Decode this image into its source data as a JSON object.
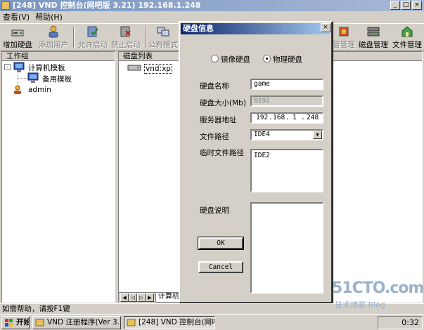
{
  "window": {
    "title": "[248] VND 控制台(网吧版 3.21) 192.168.1.248",
    "min": "_",
    "max": "□",
    "close": "×"
  },
  "menu": [
    "查看(V)",
    "帮助(H)"
  ],
  "toolbar": [
    {
      "label": "增加硬盘",
      "icon": "add-disk-icon"
    },
    {
      "label": "添加用户",
      "icon": "add-user-icon"
    },
    {
      "label": "允许启动",
      "icon": "allow-boot-icon"
    },
    {
      "label": "禁止启动",
      "icon": "deny-boot-icon"
    },
    {
      "label": "公有模式",
      "icon": "public-mode-icon"
    },
    {
      "label": "管管理",
      "icon": "manage-icon"
    },
    {
      "label": "磁盘管理",
      "icon": "disk-manage-icon"
    },
    {
      "label": "文件管理",
      "icon": "file-manage-icon"
    }
  ],
  "left_pane": {
    "header": "工作组",
    "tree": [
      "计算机模板",
      "备用模板",
      "admin"
    ]
  },
  "right_pane": {
    "header": "磁盘列表",
    "items": [
      "vnd:xp"
    ],
    "bottom_tab": "计算机"
  },
  "dialog": {
    "title": "硬盘信息",
    "close": "×",
    "radio_mirror": "镜像硬盘",
    "radio_physical": "物理硬盘",
    "selected_radio": "physical",
    "name_label": "硬盘名称",
    "name_value": "game",
    "size_label": "硬盘大小(Mb)",
    "size_value": "8192",
    "server_label": "服务器地址",
    "server_ip": [
      "192",
      "168",
      "1",
      "248"
    ],
    "path_label": "文件路径",
    "path_value": "IDE4",
    "temp_path_label": "临时文件路径",
    "temp_path_value": "IDE2",
    "desc_label": "硬盘说明",
    "desc_value": "",
    "ok": "OK",
    "cancel": "Cancel"
  },
  "status": "如需帮助，请按F1键",
  "taskbar": {
    "start": "开始",
    "tasks": [
      "VND 注册程序(Ver 3.21)",
      "[248] VND 控制台(网吧..."
    ],
    "clock": "0:32"
  },
  "watermark": {
    "main": "51CTO.com",
    "sub": "技术博客 Blog"
  }
}
